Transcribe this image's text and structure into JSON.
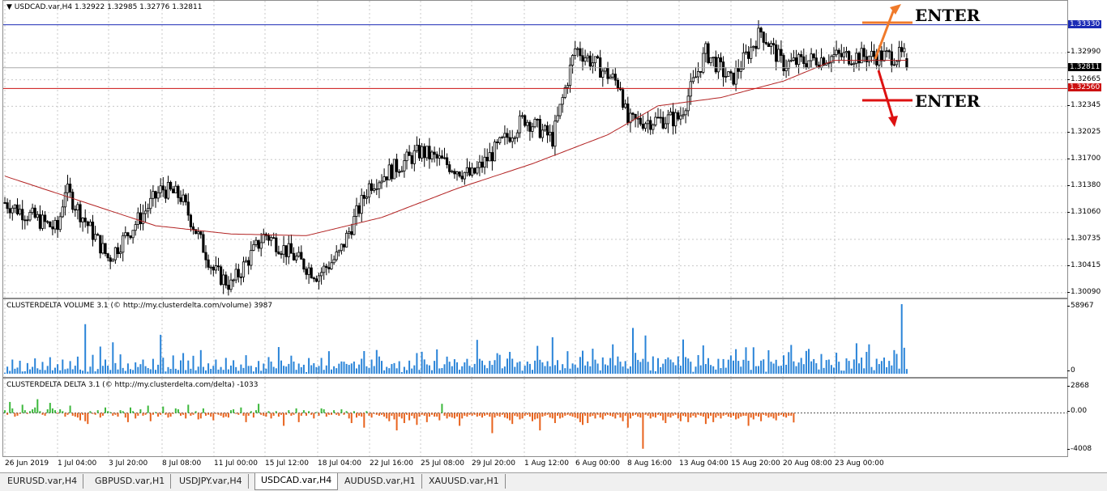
{
  "symbol_title": "USDCAD.var,H4  1.32922 1.32985 1.32776 1.32811",
  "colors": {
    "bull": "#000000",
    "bear": "#000000",
    "ma": "#b22222",
    "vol_bar": "#2a84d8",
    "delta_pos": "#3cb83c",
    "delta_neg": "#e8631e",
    "blue_level": "#1b2bb5",
    "red_level": "#cc1111",
    "enter_up": "#f07a2a",
    "enter_down": "#dd1111",
    "grid": "#c8c8c8"
  },
  "main_axis": {
    "ticks": [
      "1.32990",
      "1.32665",
      "1.32345",
      "1.32025",
      "1.31700",
      "1.31380",
      "1.31060",
      "1.30735",
      "1.30415",
      "1.30090"
    ],
    "level_blue": "1.33330",
    "level_current": "1.32811",
    "level_red": "1.32560"
  },
  "annotations": {
    "enter_up": "ENTER",
    "enter_down": "ENTER"
  },
  "volume": {
    "label": "CLUSTERDELTA VOLUME 3.1 (© http://my.clusterdelta.com/volume) 3987",
    "axis_top": "58967",
    "axis_bottom": "0"
  },
  "delta": {
    "label": "CLUSTERDELTA DELTA 3.1 (© http://my.clusterdelta.com/delta) -1033",
    "axis_top": "2868",
    "axis_zero": "0.00",
    "axis_bottom": "-4008"
  },
  "time_labels": [
    "26 Jun 2019",
    "1 Jul 04:00",
    "3 Jul 20:00",
    "8 Jul 08:00",
    "11 Jul 00:00",
    "15 Jul 12:00",
    "18 Jul 04:00",
    "22 Jul 16:00",
    "25 Jul 08:00",
    "29 Jul 20:00",
    "1 Aug 12:00",
    "6 Aug 00:00",
    "8 Aug 16:00",
    "13 Aug 04:00",
    "15 Aug 20:00",
    "20 Aug 08:00",
    "23 Aug 00:00"
  ],
  "tabs": [
    {
      "label": "EURUSD.var,H4",
      "active": false
    },
    {
      "label": "GBPUSD.var,H1",
      "active": false
    },
    {
      "label": "USDJPY.var,H4",
      "active": false
    },
    {
      "label": "USDCAD.var,H4",
      "active": true
    },
    {
      "label": "AUDUSD.var,H1",
      "active": false
    },
    {
      "label": "XAUUSD.var,H1",
      "active": false
    }
  ],
  "chart_data": [
    {
      "type": "candlestick",
      "title": "USDCAD.var,H4",
      "ohlc_last": {
        "open": 1.32922,
        "high": 1.32985,
        "low": 1.32776,
        "close": 1.32811
      },
      "ylim": [
        1.3003,
        1.3362
      ],
      "price_path_anchors": [
        [
          "26 Jun 2019",
          1.3118
        ],
        [
          "1 Jul 04:00",
          1.3085
        ],
        [
          "1 Jul 20:00",
          1.3135
        ],
        [
          "3 Jul 20:00",
          1.305
        ],
        [
          "8 Jul 08:00",
          1.3135
        ],
        [
          "9 Jul 12:00",
          1.3125
        ],
        [
          "11 Jul 00:00",
          1.3035
        ],
        [
          "12 Jul 04:00",
          1.3018
        ],
        [
          "15 Jul 12:00",
          1.308
        ],
        [
          "18 Jul 04:00",
          1.303
        ],
        [
          "19 Jul 12:00",
          1.3055
        ],
        [
          "22 Jul 16:00",
          1.314
        ],
        [
          "25 Jul 08:00",
          1.318
        ],
        [
          "29 Jul 20:00",
          1.315
        ],
        [
          "1 Aug 12:00",
          1.322
        ],
        [
          "2 Aug 16:00",
          1.3195
        ],
        [
          "6 Aug 00:00",
          1.3305
        ],
        [
          "7 Aug 08:00",
          1.326
        ],
        [
          "8 Aug 16:00",
          1.3215
        ],
        [
          "13 Aug 04:00",
          1.322
        ],
        [
          "13 Aug 20:00",
          1.33
        ],
        [
          "15 Aug 20:00",
          1.3265
        ],
        [
          "16 Aug 16:00",
          1.3325
        ],
        [
          "20 Aug 08:00",
          1.3285
        ],
        [
          "23 Aug 00:00",
          1.3295
        ]
      ],
      "series": [
        {
          "name": "moving average",
          "anchors": [
            [
              0,
              1.315
            ],
            [
              30,
              1.312
            ],
            [
              60,
              1.309
            ],
            [
              90,
              1.308
            ],
            [
              120,
              1.3078
            ],
            [
              150,
              1.31
            ],
            [
              180,
              1.3135
            ],
            [
              210,
              1.3165
            ],
            [
              240,
              1.32
            ],
            [
              260,
              1.3235
            ],
            [
              285,
              1.3245
            ],
            [
              310,
              1.3265
            ],
            [
              330,
              1.329
            ]
          ]
        }
      ],
      "levels": {
        "blue": 1.3333,
        "red": 1.3256
      }
    },
    {
      "type": "bar",
      "title": "CLUSTERDELTA VOLUME 3.1",
      "ylim": [
        0,
        58967
      ],
      "values": [
        800,
        6000,
        2400,
        12000,
        4200,
        5200,
        11000,
        1900,
        2100,
        9000,
        3700,
        5800,
        13000,
        4600,
        3400,
        10000,
        3100,
        6600,
        14000,
        2900,
        5100,
        8100,
        2900,
        12000,
        3800,
        4400,
        10700,
        3800,
        6800,
        14500,
        3500,
        2600,
        42000,
        1700,
        6000,
        16000,
        2000,
        4000,
        23000,
        6700,
        12000,
        6800,
        3200,
        26600,
        9000,
        3600,
        16400,
        4900,
        2400,
        8700,
        3900,
        3200,
        9600,
        5700,
        8100,
        12000,
        6400,
        4800,
        3800,
        12600,
        3300,
        7600,
        33000,
        13600,
        1900,
        5600,
        4100,
        15500,
        4200,
        3200,
        11300,
        17500,
        3100,
        11200,
        4200,
        15200,
        2900,
        6000,
        20000,
        5800,
        2800,
        8800,
        4100,
        6700,
        12000,
        3500,
        5700,
        3300,
        13400,
        3700,
        6900,
        11400,
        5600,
        2500,
        7800,
        4900,
        15700,
        6600,
        6700,
        1900,
        5500,
        10800,
        2500,
        8600,
        4300,
        14100,
        10300,
        5800,
        4600,
        22600,
        11200,
        6700,
        6100,
        8300,
        15300,
        10300,
        3300,
        8600,
        5500,
        7600,
        1400,
        13300,
        7200,
        8900,
        5600,
        6600,
        13400,
        3300,
        7000,
        19100,
        3600,
        6300,
        4700,
        8500,
        10400,
        10200,
        8300,
        7500,
        8700,
        10300,
        4500,
        7800,
        12700,
        19200,
        6300,
        5000,
        12000,
        6500,
        20100,
        14600,
        10900,
        2900,
        5800,
        4700,
        8200,
        9000,
        4600,
        10600,
        1400,
        5800,
        3100,
        11100,
        4400,
        7100,
        17500,
        3300,
        18600,
        12100,
        7900,
        7100,
        3000,
        10900,
        20600,
        4500,
        4800,
        8000,
        14500,
        10200,
        6400,
        12300,
        9700,
        3400,
        6300,
        9600,
        12600,
        6700,
        5400,
        8300,
        28700,
        12600,
        11100,
        7300,
        4700,
        10900,
        7500,
        11500,
        17400,
        16000,
        4600,
        6100,
        12800,
        18500,
        12700,
        5800,
        9500,
        10400,
        2600,
        6800,
        10300,
        8300,
        3300,
        11100,
        23600,
        11800,
        9600,
        6500,
        10600,
        6300,
        30900,
        7300,
        11500,
        3000,
        8100,
        4700,
        19100,
        4300,
        8700,
        7700,
        5100,
        14200,
        19500,
        7000,
        10400,
        6300,
        21200,
        11900,
        8600,
        2800,
        13800,
        7900,
        7100,
        13300,
        24900,
        7100,
        14600,
        10200,
        6100,
        10700,
        4300,
        6200,
        38800,
        17700,
        11700,
        10000,
        12600,
        32400,
        10100,
        2800,
        14700,
        2100,
        13200,
        5500,
        8500,
        12300,
        13800,
        12000,
        9700,
        7200,
        14700,
        6800,
        29000,
        14100,
        12900,
        10200,
        1600,
        6000,
        15800,
        7100,
        24000,
        8200,
        13200,
        7400,
        6300,
        3500,
        12600,
        4800,
        12400,
        5100,
        11900,
        15500,
        11100,
        20800,
        10900,
        6000,
        11800,
        22400,
        11000,
        3300,
        22400,
        6400,
        6500,
        11100,
        12200,
        1700,
        19900,
        10200,
        8600,
        11800,
        6500,
        6800,
        15600,
        7600,
        18300,
        24400,
        10500,
        6400,
        9500,
        13400,
        8100,
        19300,
        21000,
        10500,
        12400,
        8900,
        3600,
        16700,
        4900,
        11600,
        12000,
        7400,
        5200,
        17800,
        10200,
        2700,
        2600,
        13000,
        10900,
        4300,
        12100,
        25800,
        8800,
        13700,
        4600,
        18500,
        24900,
        5700,
        3000,
        12700,
        8200,
        10800,
        13700,
        5500,
        10900,
        7000,
        20000,
        16800,
        4300,
        58967,
        22000,
        3987
      ]
    },
    {
      "type": "bar",
      "title": "CLUSTERDELTA DELTA 3.1",
      "ylim": [
        -4008,
        2868
      ],
      "values": [
        300,
        -200,
        1200,
        500,
        -400,
        -300,
        -100,
        900,
        300,
        -100,
        200,
        400,
        600,
        1500,
        200,
        -200,
        -300,
        400,
        1100,
        500,
        300,
        -100,
        400,
        200,
        -400,
        -200,
        800,
        -300,
        -400,
        -500,
        -800,
        -200,
        -900,
        -1200,
        200,
        -100,
        -200,
        300,
        -500,
        -300,
        600,
        200,
        100,
        -300,
        -200,
        -400,
        300,
        200,
        -500,
        -1000,
        600,
        200,
        -600,
        -300,
        400,
        -300,
        -200,
        800,
        -900,
        -200,
        100,
        -400,
        -200,
        700,
        -200,
        -500,
        -400,
        -100,
        500,
        400,
        -300,
        -200,
        -600,
        900,
        -300,
        -200,
        200,
        -700,
        -600,
        500,
        -300,
        -200,
        -400,
        -800,
        -100,
        -200,
        -300,
        -500,
        -400,
        -500,
        300,
        400,
        -100,
        -200,
        600,
        -300,
        -1000,
        -300,
        200,
        -500,
        300,
        1000,
        -200,
        -300,
        -400,
        200,
        -600,
        -300,
        200,
        -400,
        -200,
        -1400,
        -200,
        300,
        -300,
        -200,
        500,
        -1000,
        -300,
        300,
        -300,
        200,
        -200,
        -600,
        100,
        -300,
        500,
        400,
        -400,
        -200,
        -200,
        300,
        -200,
        -300,
        400,
        -200,
        200,
        -600,
        -1100,
        200,
        -500,
        -300,
        -400,
        -1600,
        200,
        -300,
        -500,
        -100,
        -200,
        -300,
        -200,
        -400,
        -600,
        -900,
        -300,
        -700,
        -1900,
        -400,
        -600,
        -1100,
        -200,
        -800,
        -300,
        -600,
        -1300,
        -400,
        -200,
        -300,
        -1000,
        -400,
        -200,
        -400,
        -400,
        -800,
        1000,
        -300,
        -600,
        -400,
        -500,
        -600,
        -400,
        -1400,
        -600,
        -300,
        -400,
        -200,
        -300,
        -200,
        -400,
        -300,
        -500,
        -300,
        -200,
        -400,
        -2200,
        -500,
        -300,
        -400,
        -200,
        -500,
        -600,
        -800,
        -1200,
        -300,
        -400,
        -700,
        -600,
        -300,
        -200,
        -400,
        -900,
        -700,
        -600,
        -1900,
        -400,
        -300,
        -200,
        -500,
        -600,
        -1100,
        -300,
        -600,
        -500,
        -300,
        -200,
        -300,
        -400,
        -500,
        -600,
        -1000,
        -1300,
        -300,
        -1100,
        -400,
        -300,
        -600,
        -200,
        -500,
        -700,
        -300,
        -200,
        -300,
        -400,
        -600,
        -200,
        -500,
        -900,
        -300,
        -1600,
        -600,
        -300,
        -200,
        -400,
        -500,
        -3900,
        -200,
        -300,
        -600,
        -400,
        -500,
        -200,
        -300,
        -800,
        -1100,
        -400,
        -500,
        -300,
        -200,
        -600,
        -900,
        -300,
        -400,
        -1000,
        -500,
        -300,
        -500,
        -200,
        -300,
        -400,
        -1200,
        -600,
        -300,
        -1000,
        -500,
        -300,
        -600,
        -300,
        -200,
        -400,
        -500,
        -300,
        -700,
        -600,
        -400,
        -300,
        -300,
        -1400,
        -500,
        -700,
        -300,
        -400,
        -900,
        -200,
        -300,
        -500,
        -400,
        -600,
        -800,
        -300,
        -200,
        -400,
        -500,
        -300,
        -300,
        -1033
      ]
    }
  ]
}
